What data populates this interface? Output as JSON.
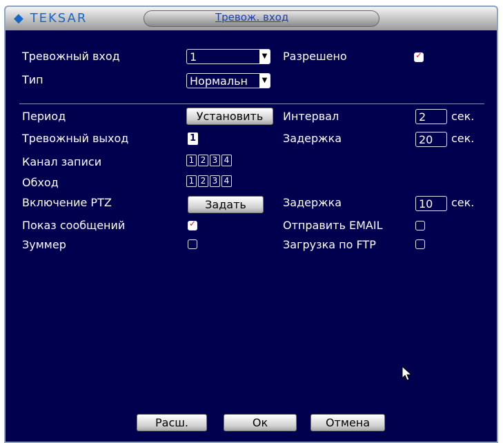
{
  "header": {
    "brand": "TEKSAR",
    "title": "Тревож. вход"
  },
  "row1": {
    "alarm_input_label": "Тревожный вход",
    "alarm_input_value": "1",
    "enabled_label": "Разрешено",
    "enabled": true
  },
  "row2": {
    "type_label": "Тип",
    "type_value": "Нормальн"
  },
  "period": {
    "label": "Период",
    "button": "Установить",
    "interval_label": "Интервал",
    "interval_value": "2",
    "unit": "сек."
  },
  "alarm_output": {
    "label": "Тревожный выход",
    "value": "1",
    "delay_label": "Задержка",
    "delay_value": "20",
    "unit": "сек."
  },
  "record_channel": {
    "label": "Канал записи",
    "channels": [
      "1",
      "2",
      "3",
      "4"
    ]
  },
  "tour": {
    "label": "Обход",
    "channels": [
      "1",
      "2",
      "3",
      "4"
    ]
  },
  "ptz": {
    "label": "Включение PTZ",
    "button": "Задать",
    "delay_label": "Задержка",
    "delay_value": "10",
    "unit": "сек."
  },
  "show_message": {
    "label": "Показ сообщений",
    "checked": true
  },
  "send_email": {
    "label": "Отправить EMAIL",
    "checked": false
  },
  "buzzer": {
    "label": "Зуммер",
    "checked": false
  },
  "ftp_upload": {
    "label": "Загрузка по FTP",
    "checked": false
  },
  "footer": {
    "advanced": "Расш.",
    "ok": "Ок",
    "cancel": "Отмена"
  },
  "colors": {
    "panel": "#00004f",
    "text": "#ffffff",
    "check_mark": "#e0203a"
  }
}
